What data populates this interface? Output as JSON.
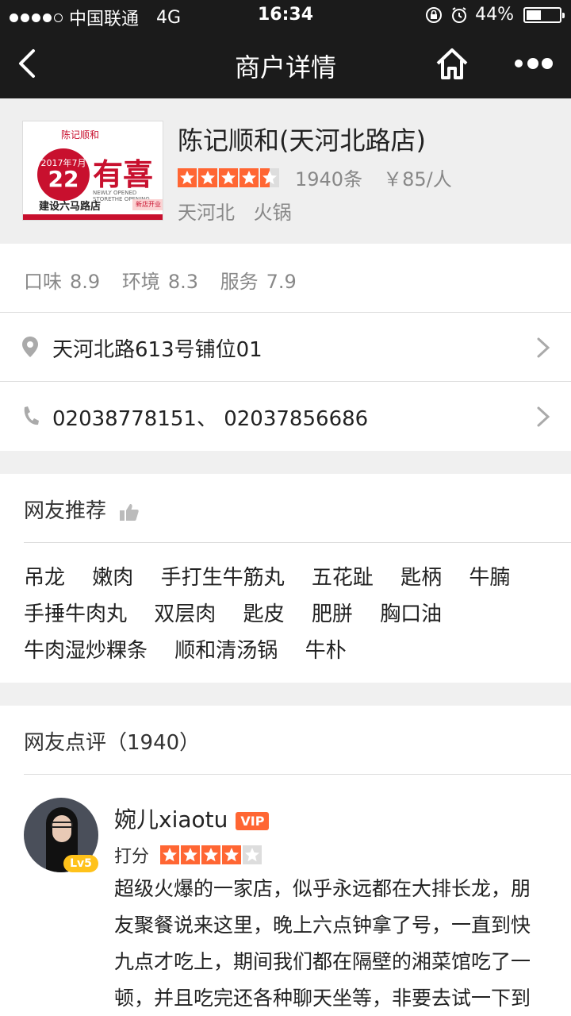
{
  "status_bar": {
    "carrier": "中国联通",
    "network": "4G",
    "time": "16:34",
    "battery": "44%",
    "battery_level": 0.44
  },
  "nav": {
    "title": "商户详情"
  },
  "merchant": {
    "name": "陈记顺和(天河北路店)",
    "rating": 4.5,
    "review_count": "1940条",
    "price": "￥85/人",
    "area": "天河北",
    "category": "火锅",
    "logo": {
      "brand": "陈记顺和",
      "date_line": "2017年7月",
      "day": "22",
      "headline": "有喜",
      "subline": "NEWLY OPENED STORETHE OPENING",
      "address": "建设六马路店",
      "badge": "新店开业"
    }
  },
  "scores": {
    "taste_label": "口味",
    "taste": "8.9",
    "env_label": "环境",
    "env": "8.3",
    "service_label": "服务",
    "service": "7.9"
  },
  "address": "天河北路613号铺位01",
  "phone": "02038778151、 02037856686",
  "recommend": {
    "title": "网友推荐",
    "dishes": [
      "吊龙",
      "嫩肉",
      "手打生牛筋丸",
      "五花趾",
      "匙柄",
      "牛腩",
      "手捶牛肉丸",
      "双层肉",
      "匙皮",
      "肥胼",
      "胸口油",
      "牛肉湿炒粿条",
      "顺和清汤锅",
      "牛朴"
    ]
  },
  "reviews": {
    "title": "网友点评（1940）",
    "items": [
      {
        "user": "婉儿xiaotu",
        "vip": "VIP",
        "level": "Lv5",
        "score_label": "打分",
        "rating": 4,
        "text": "超级火爆的一家店，似乎永远都在大排长龙，朋友聚餐说来这里，晚上六点钟拿了号，一直到快九点才吃上，期间我们都在隔壁的湘菜馆吃了一顿，并且吃完还各种聊天坐等，非要去试一下到底是有多好吃，其实这家店的装修啊"
      }
    ]
  }
}
